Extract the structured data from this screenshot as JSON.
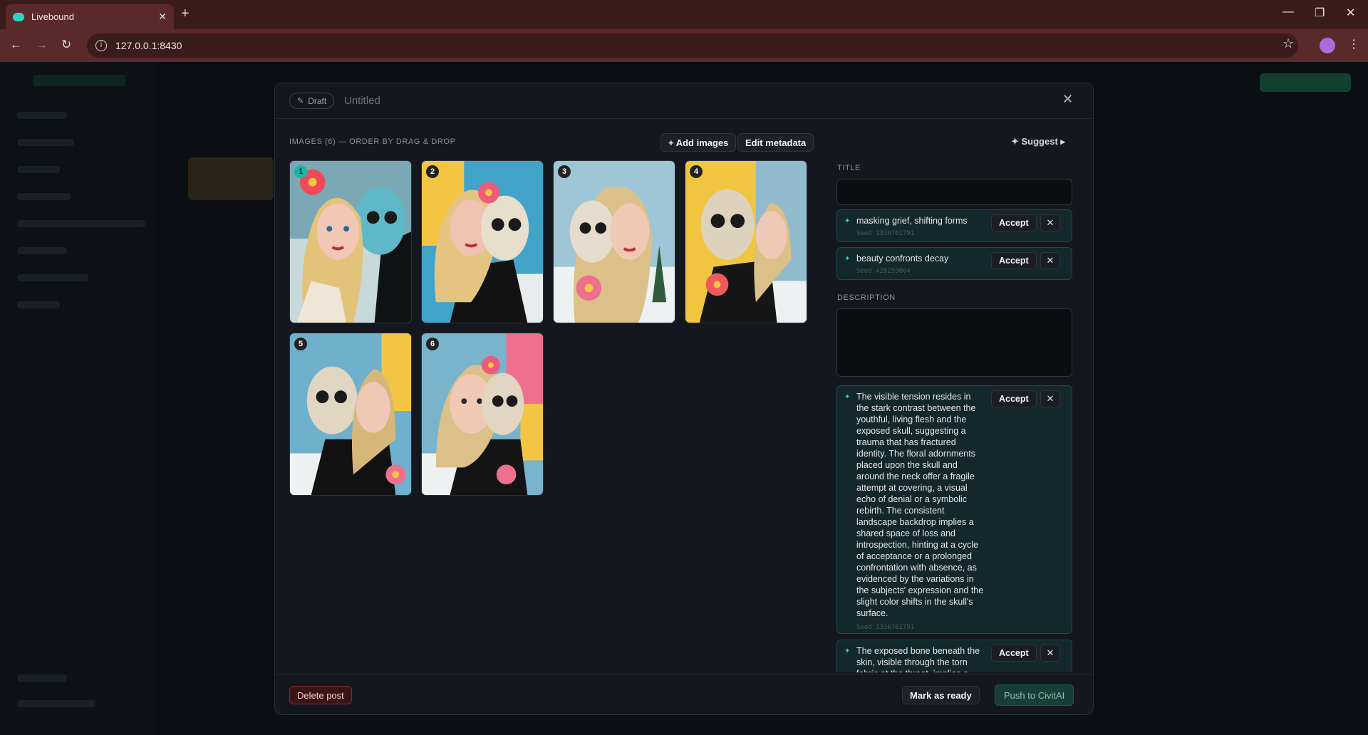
{
  "browser": {
    "tab_title": "Livebound",
    "tab_close": "✕",
    "new_tab": "+",
    "url": "127.0.0.1:8430"
  },
  "modal": {
    "status": "Draft",
    "title": "Untitled",
    "close": "✕",
    "images_label": "IMAGES (6) — ORDER BY DRAG & DROP",
    "add_images": "+ Add images",
    "edit_metadata": "Edit metadata",
    "suggest": "✦ Suggest ▸",
    "images": [
      {
        "num": "1"
      },
      {
        "num": "2"
      },
      {
        "num": "3"
      },
      {
        "num": "4"
      },
      {
        "num": "5"
      },
      {
        "num": "6"
      }
    ],
    "title_label": "TITLE",
    "description_label": "DESCRIPTION",
    "accept": "Accept",
    "reject": "✕",
    "title_suggestions": [
      {
        "text": "masking grief, shifting forms",
        "seed": "Seed 1336761791"
      },
      {
        "text": "beauty confronts decay",
        "seed": "Seed 428259004"
      }
    ],
    "description_suggestions": [
      {
        "text": "The visible tension resides in the stark contrast between the youthful, living flesh and the exposed skull, suggesting a trauma that has fractured identity. The floral adornments placed upon the skull and around the neck offer a fragile attempt at covering, a visual echo of denial or a symbolic rebirth. The consistent landscape backdrop implies a shared space of loss and introspection, hinting at a cycle of acceptance or a prolonged confrontation with absence, as evidenced by the variations in the subjects' expression and the slight color shifts in the skull's surface.",
        "seed": "Seed 1336761791"
      },
      {
        "text": "The exposed bone beneath the skin, visible through the torn fabric at the throat, implies a",
        "seed": ""
      }
    ],
    "delete_post": "Delete post",
    "mark_ready": "Mark as ready",
    "push": "Push to CivitAI"
  }
}
